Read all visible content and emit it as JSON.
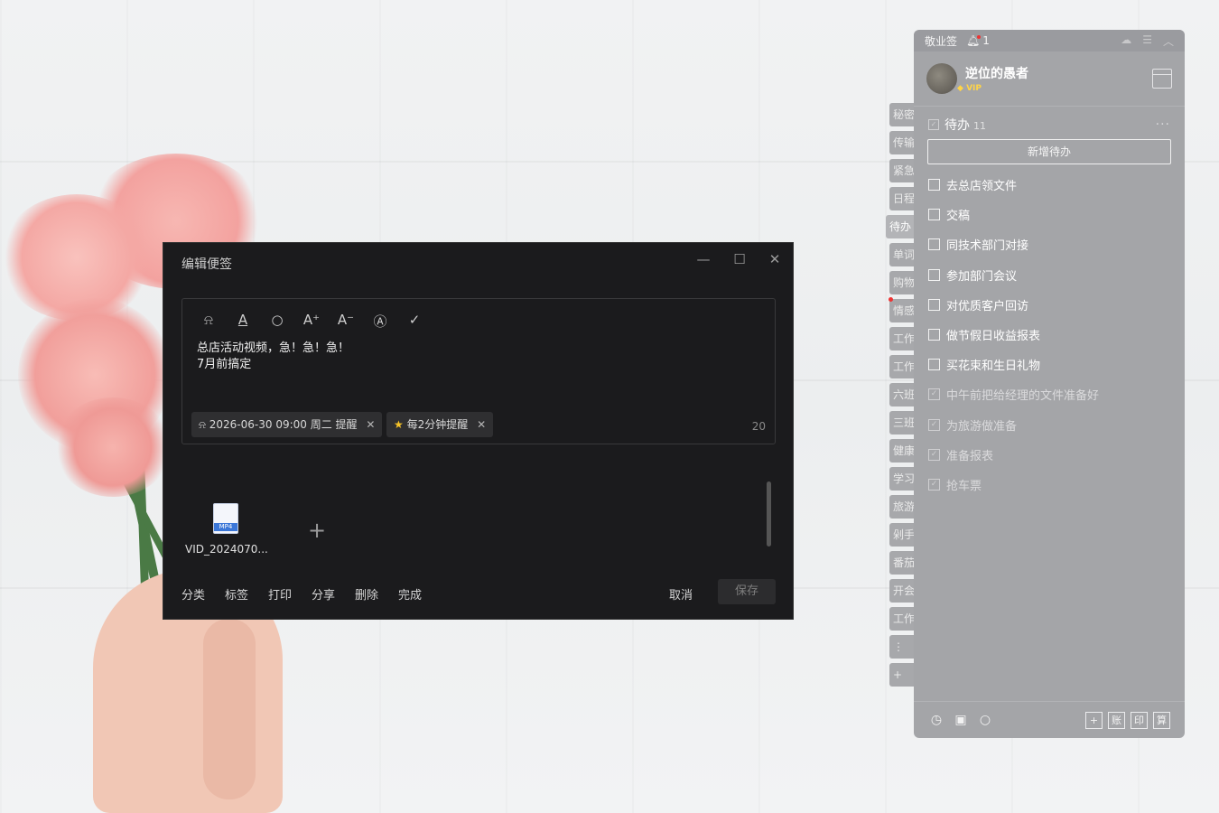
{
  "sidebar_widget": {
    "app_name": "敬业签",
    "notification_count": "1",
    "user": {
      "name": "逆位的愚者",
      "badge": "VIP"
    },
    "section": {
      "title": "待办",
      "count": "11",
      "more": "···"
    },
    "add_button": "新增待办",
    "todos": [
      {
        "text": "去总店领文件",
        "done": false
      },
      {
        "text": "交稿",
        "done": false
      },
      {
        "text": "同技术部门对接",
        "done": false
      },
      {
        "text": "参加部门会议",
        "done": false
      },
      {
        "text": "对优质客户回访",
        "done": false
      },
      {
        "text": "做节假日收益报表",
        "done": false
      },
      {
        "text": "买花束和生日礼物",
        "done": false
      },
      {
        "text": "中午前把给经理的文件准备好",
        "done": true
      },
      {
        "text": "为旅游做准备",
        "done": true
      },
      {
        "text": "准备报表",
        "done": true
      },
      {
        "text": "抢车票",
        "done": true
      }
    ],
    "bottom_buttons": [
      "+",
      "账",
      "印",
      "算"
    ]
  },
  "side_tabs": [
    {
      "label": "秘密"
    },
    {
      "label": "传输"
    },
    {
      "label": "紧急"
    },
    {
      "label": "日程"
    },
    {
      "label": "待办",
      "active": true
    },
    {
      "label": "单词"
    },
    {
      "label": "购物"
    },
    {
      "label": "情感"
    },
    {
      "label": "工作"
    },
    {
      "label": "工作"
    },
    {
      "label": "六班"
    },
    {
      "label": "三班"
    },
    {
      "label": "健康"
    },
    {
      "label": "学习"
    },
    {
      "label": "旅游"
    },
    {
      "label": "剁手"
    },
    {
      "label": "番茄"
    },
    {
      "label": "开会"
    },
    {
      "label": "工作"
    },
    {
      "label": "⋮"
    },
    {
      "label": "+"
    }
  ],
  "editor": {
    "title": "编辑便签",
    "controls": {
      "minimize": "—",
      "maximize": "☐",
      "close": "✕"
    },
    "toolbar_icons": [
      "bell-icon",
      "font-color-icon",
      "search-icon",
      "font-increase-icon",
      "font-decrease-icon",
      "format-clear-icon",
      "check-icon"
    ],
    "content": "总店活动视频，急！急！急！\n7月前搞定",
    "reminder_chip": "2026-06-30 09:00 周二 提醒",
    "repeat_chip": "每2分钟提醒",
    "char_count": "20",
    "attachment": {
      "name": "VID_2024070...",
      "type_label": "MP4"
    },
    "actions": [
      "分类",
      "标签",
      "打印",
      "分享",
      "删除",
      "完成"
    ],
    "cancel_label": "取消",
    "save_label": "保存"
  }
}
